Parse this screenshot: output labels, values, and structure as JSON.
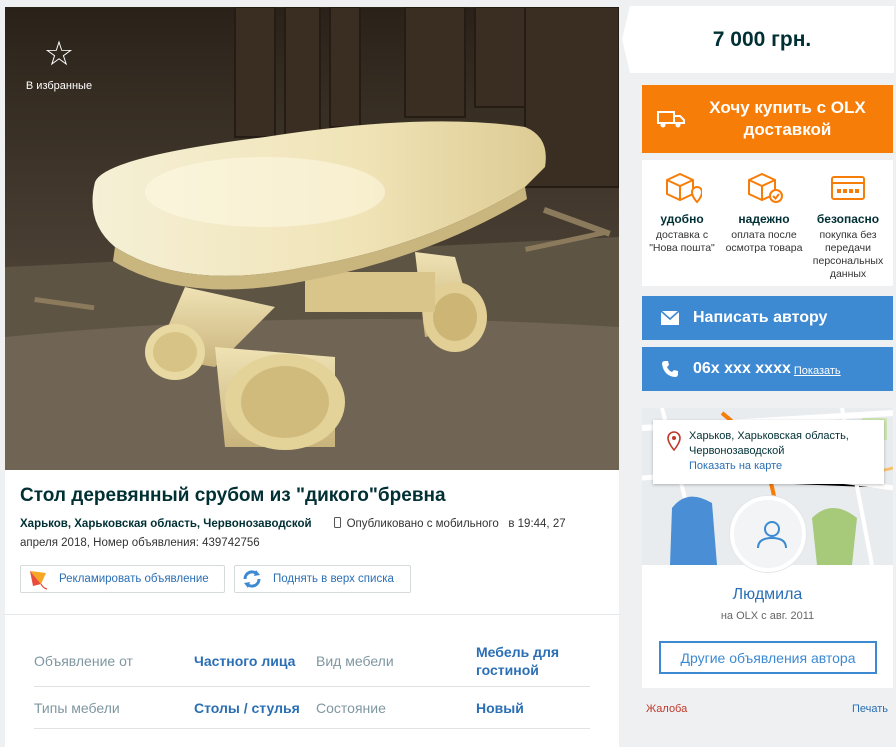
{
  "listing": {
    "favorite_label": "В избранные",
    "title": "Стол деревянный срубом из \"дикого\"бревна",
    "location": "Харьков, Харьковская область, Червонозаводской",
    "published": "Опубликовано с мобильного",
    "published_at": "в 19:44, 27 апреля 2018,",
    "ad_number": "Номер объявления: 439742756",
    "promote_label": "Рекламировать объявление",
    "raise_label": "Поднять в верх списка"
  },
  "params": {
    "rows": [
      {
        "k1": "Объявление от",
        "v1": "Частного лица",
        "k2": "Вид мебели",
        "v2": "Мебель для гостиной"
      },
      {
        "k1": "Типы мебели",
        "v1": "Столы / стулья",
        "k2": "Состояние",
        "v2": "Новый"
      }
    ]
  },
  "sidebar": {
    "price": "7 000 грн.",
    "buy_label": "Хочу купить с OLX доставкой",
    "benefits": [
      {
        "title": "удобно",
        "desc": "доставка с \"Нова пошта\"",
        "icon": "box-pin-icon"
      },
      {
        "title": "надежно",
        "desc": "оплата после осмотра товара",
        "icon": "box-check-icon"
      },
      {
        "title": "безопасно",
        "desc": "покупка без передачи персональных данных",
        "icon": "card-icon"
      }
    ],
    "message_label": "Написать автору",
    "phone_number": "06x xxx xxxx",
    "phone_show": "Показать",
    "location_text": "Харьков, Харьковская область, Червонозаводской",
    "map_link": "Показать на карте",
    "seller_name": "Людмила",
    "seller_since": "на OLX с авг. 2011",
    "other_ads": "Другие объявления автора",
    "report": "Жалоба",
    "print": "Печать"
  },
  "colors": {
    "accent_orange": "#f77d09",
    "accent_blue": "#3d8ad3",
    "link_blue": "#2a6fb5",
    "text_dark": "#002f34"
  }
}
